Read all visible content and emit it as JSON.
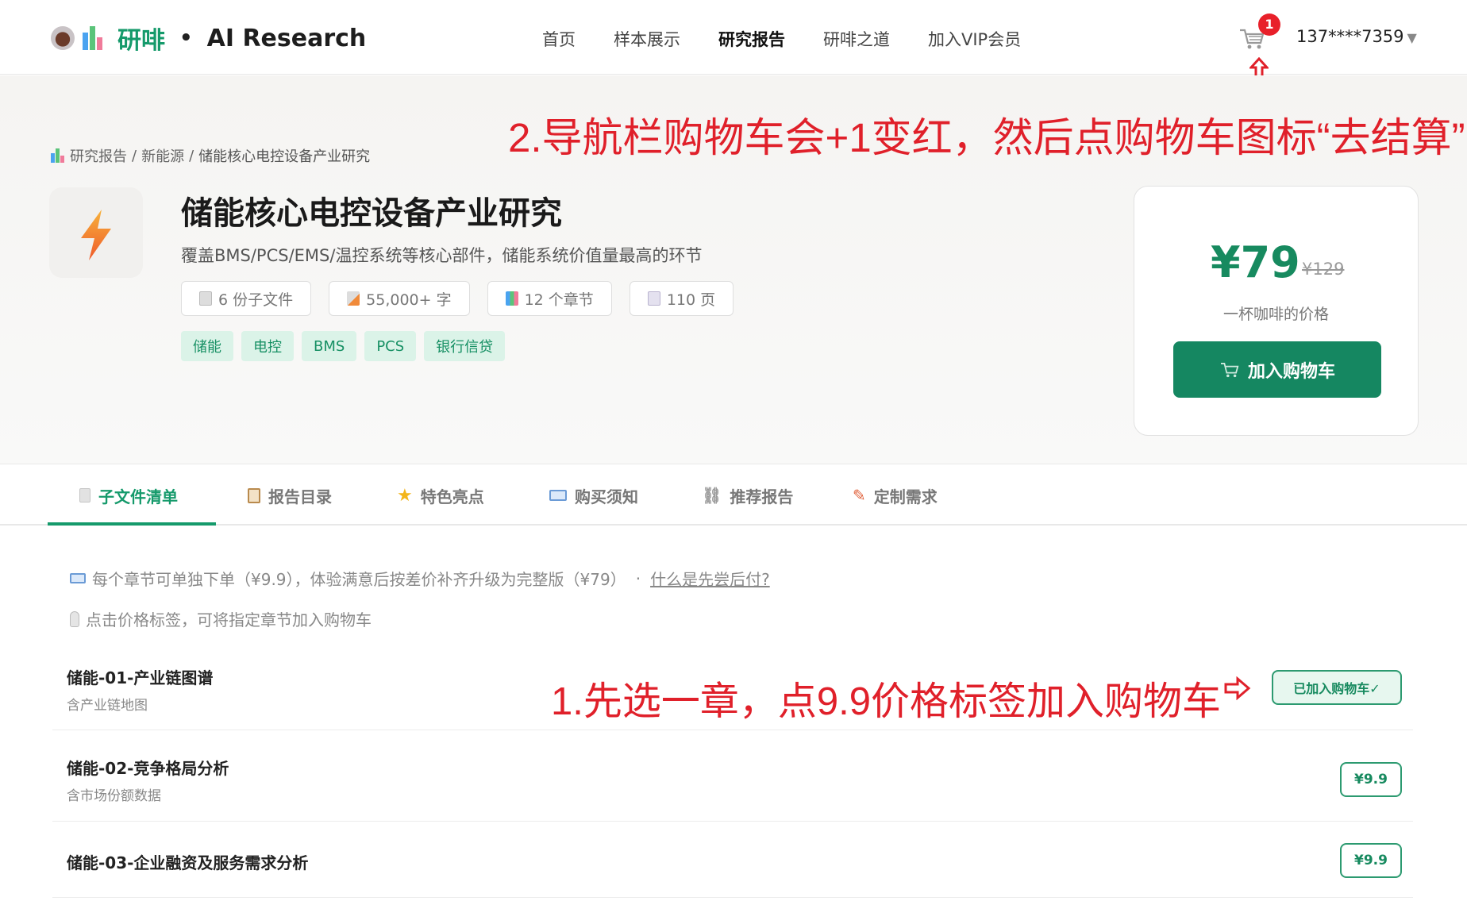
{
  "header": {
    "brand": "研啡",
    "separator": "•",
    "subtitle": "AI Research",
    "nav": [
      "首页",
      "样本展示",
      "研究报告",
      "研啡之道",
      "加入VIP会员"
    ],
    "active_nav": "研究报告",
    "cart_count": "1",
    "user": "137****7359",
    "user_caret": "▼"
  },
  "annotations": {
    "step2": "2.导航栏购物车会+1变红，然后点购物车图标“去结算”",
    "step1": "1.先选一章，点9.9价格标签加入购物车"
  },
  "breadcrumb": {
    "items": [
      "研究报告",
      "新能源",
      "储能核心电控设备产业研究"
    ],
    "sep": "/"
  },
  "report": {
    "title": "储能核心电控设备产业研究",
    "subtitle": "覆盖BMS/PCS/EMS/温控系统等核心部件，储能系统价值量最高的环节",
    "stats": [
      "6 份子文件",
      "55,000+ 字",
      "12 个章节",
      "110 页"
    ],
    "tags": [
      "储能",
      "电控",
      "BMS",
      "PCS",
      "银行信贷"
    ]
  },
  "pricing": {
    "price": "¥79",
    "original": "¥129",
    "note": "一杯咖啡的价格",
    "button": "加入购物车"
  },
  "tabs": [
    "子文件清单",
    "报告目录",
    "特色亮点",
    "购买须知",
    "推荐报告",
    "定制需求"
  ],
  "notes": {
    "line1": "每个章节可单独下单（¥9.9），体验满意后按差价补齐升级为完整版（¥79）",
    "line1_dot": "·",
    "line1_link": "什么是先尝后付?",
    "line2": "点击价格标签，可将指定章节加入购物车"
  },
  "chapters": [
    {
      "title": "储能-01-产业链图谱",
      "subtitle": "含产业链地图",
      "tag": "已加入购物车✓"
    },
    {
      "title": "储能-02-竞争格局分析",
      "subtitle": "含市场份额数据",
      "tag": "¥9.9"
    },
    {
      "title": "储能-03-企业融资及服务需求分析",
      "subtitle": "",
      "tag": "¥9.9"
    }
  ]
}
